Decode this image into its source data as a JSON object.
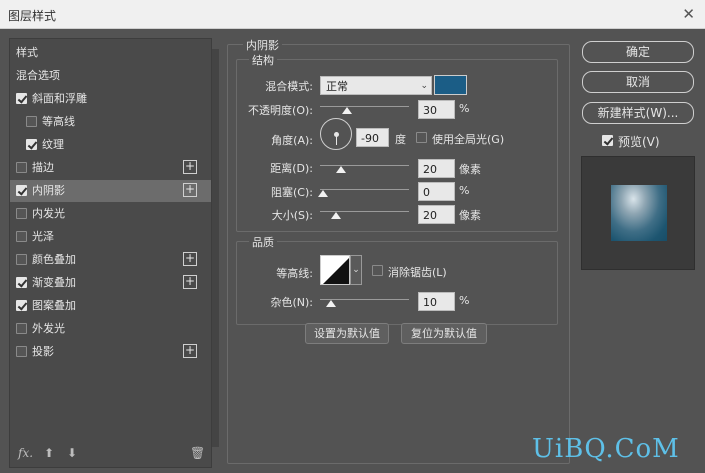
{
  "window": {
    "title": "图层样式",
    "close_glyph": "✕"
  },
  "styles_list": {
    "header": "样式",
    "blend_options": "混合选项",
    "items": [
      {
        "label": "斜面和浮雕",
        "checked": true,
        "plus": false
      },
      {
        "label": "等高线",
        "checked": false,
        "plus": false
      },
      {
        "label": "纹理",
        "checked": true,
        "plus": false
      },
      {
        "label": "描边",
        "checked": false,
        "plus": true
      },
      {
        "label": "内阴影",
        "checked": true,
        "plus": true
      },
      {
        "label": "内发光",
        "checked": false,
        "plus": false
      },
      {
        "label": "光泽",
        "checked": false,
        "plus": false
      },
      {
        "label": "颜色叠加",
        "checked": false,
        "plus": true
      },
      {
        "label": "渐变叠加",
        "checked": true,
        "plus": true
      },
      {
        "label": "图案叠加",
        "checked": true,
        "plus": false
      },
      {
        "label": "外发光",
        "checked": false,
        "plus": false
      },
      {
        "label": "投影",
        "checked": false,
        "plus": true
      }
    ],
    "fx_label": "fx.",
    "plus_glyph": "+",
    "up_glyph": "⬆",
    "down_glyph": "⬇",
    "trash_glyph": "🗑"
  },
  "inner_shadow": {
    "section_title": "内阴影",
    "structure_title": "结构",
    "blend_mode_label": "混合模式:",
    "blend_mode_value": "正常",
    "shadow_color": "#1b5d86",
    "opacity_label": "不透明度(O):",
    "opacity_value": "30",
    "opacity_unit": "%",
    "opacity_level": 0.3,
    "angle_label": "角度(A):",
    "angle_value": "-90",
    "angle_unit": "度",
    "global_light_label": "使用全局光(G)",
    "global_light_checked": false,
    "distance_label": "距离(D):",
    "distance_value": "20",
    "distance_unit": "像素",
    "choke_label": "阻塞(C):",
    "choke_value": "0",
    "choke_unit": "%",
    "size_label": "大小(S):",
    "size_value": "20",
    "size_unit": "像素",
    "quality_title": "品质",
    "contour_label": "等高线:",
    "antialias_label": "消除锯齿(L)",
    "antialias_checked": false,
    "noise_label": "杂色(N):",
    "noise_value": "10",
    "noise_unit": "%",
    "set_default": "设置为默认值",
    "reset_default": "复位为默认值"
  },
  "actions": {
    "ok": "确定",
    "cancel": "取消",
    "new_style": "新建样式(W)...",
    "preview_label": "预览(V)",
    "preview_checked": true
  },
  "watermark": "UiBQ.CoM"
}
